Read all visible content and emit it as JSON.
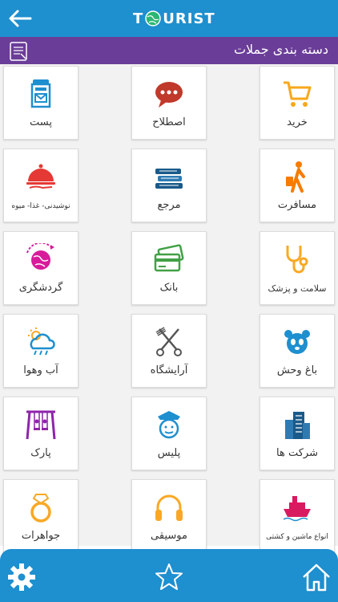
{
  "header": {
    "logo_left": "T",
    "logo_right": "URIST"
  },
  "category_bar": {
    "title": "دسته بندی جملات"
  },
  "tiles": [
    {
      "label": "خرید",
      "icon": "shopping-cart-icon",
      "color": "#f7a81b"
    },
    {
      "label": "اصطلاح",
      "icon": "speech-bubble-icon",
      "color": "#c0392b"
    },
    {
      "label": "پست",
      "icon": "mailbox-icon",
      "color": "#1e8fcf"
    },
    {
      "label": "مسافرت",
      "icon": "traveler-icon",
      "color": "#f57c00"
    },
    {
      "label": "مرجع",
      "icon": "books-icon",
      "color": "#1a5a8a"
    },
    {
      "label": "نوشیدنی- غذا- میوه",
      "icon": "food-cloche-icon",
      "color": "#e53935"
    },
    {
      "label": "سلامت و پزشک",
      "icon": "stethoscope-icon",
      "color": "#f9a825"
    },
    {
      "label": "بانک",
      "icon": "credit-card-icon",
      "color": "#43a047"
    },
    {
      "label": "گردشگری",
      "icon": "globe-plane-icon",
      "color": "#d81b9a"
    },
    {
      "label": "باغ وحش",
      "icon": "panda-icon",
      "color": "#1e8fcf"
    },
    {
      "label": "آرایشگاه",
      "icon": "scissors-comb-icon",
      "color": "#555555"
    },
    {
      "label": "آب وهوا",
      "icon": "weather-icon",
      "color": "#1e8fcf"
    },
    {
      "label": "شرکت ها",
      "icon": "buildings-icon",
      "color": "#1a5a8a"
    },
    {
      "label": "پلیس",
      "icon": "police-icon",
      "color": "#1e8fcf"
    },
    {
      "label": "پارک",
      "icon": "swing-icon",
      "color": "#8e24aa"
    },
    {
      "label": "انواع ماشین و کشتی",
      "icon": "ship-icon",
      "color": "#d81b60"
    },
    {
      "label": "موسیقی",
      "icon": "headphones-icon",
      "color": "#f9a825"
    },
    {
      "label": "جواهرات",
      "icon": "ring-icon",
      "color": "#f9a825"
    }
  ]
}
